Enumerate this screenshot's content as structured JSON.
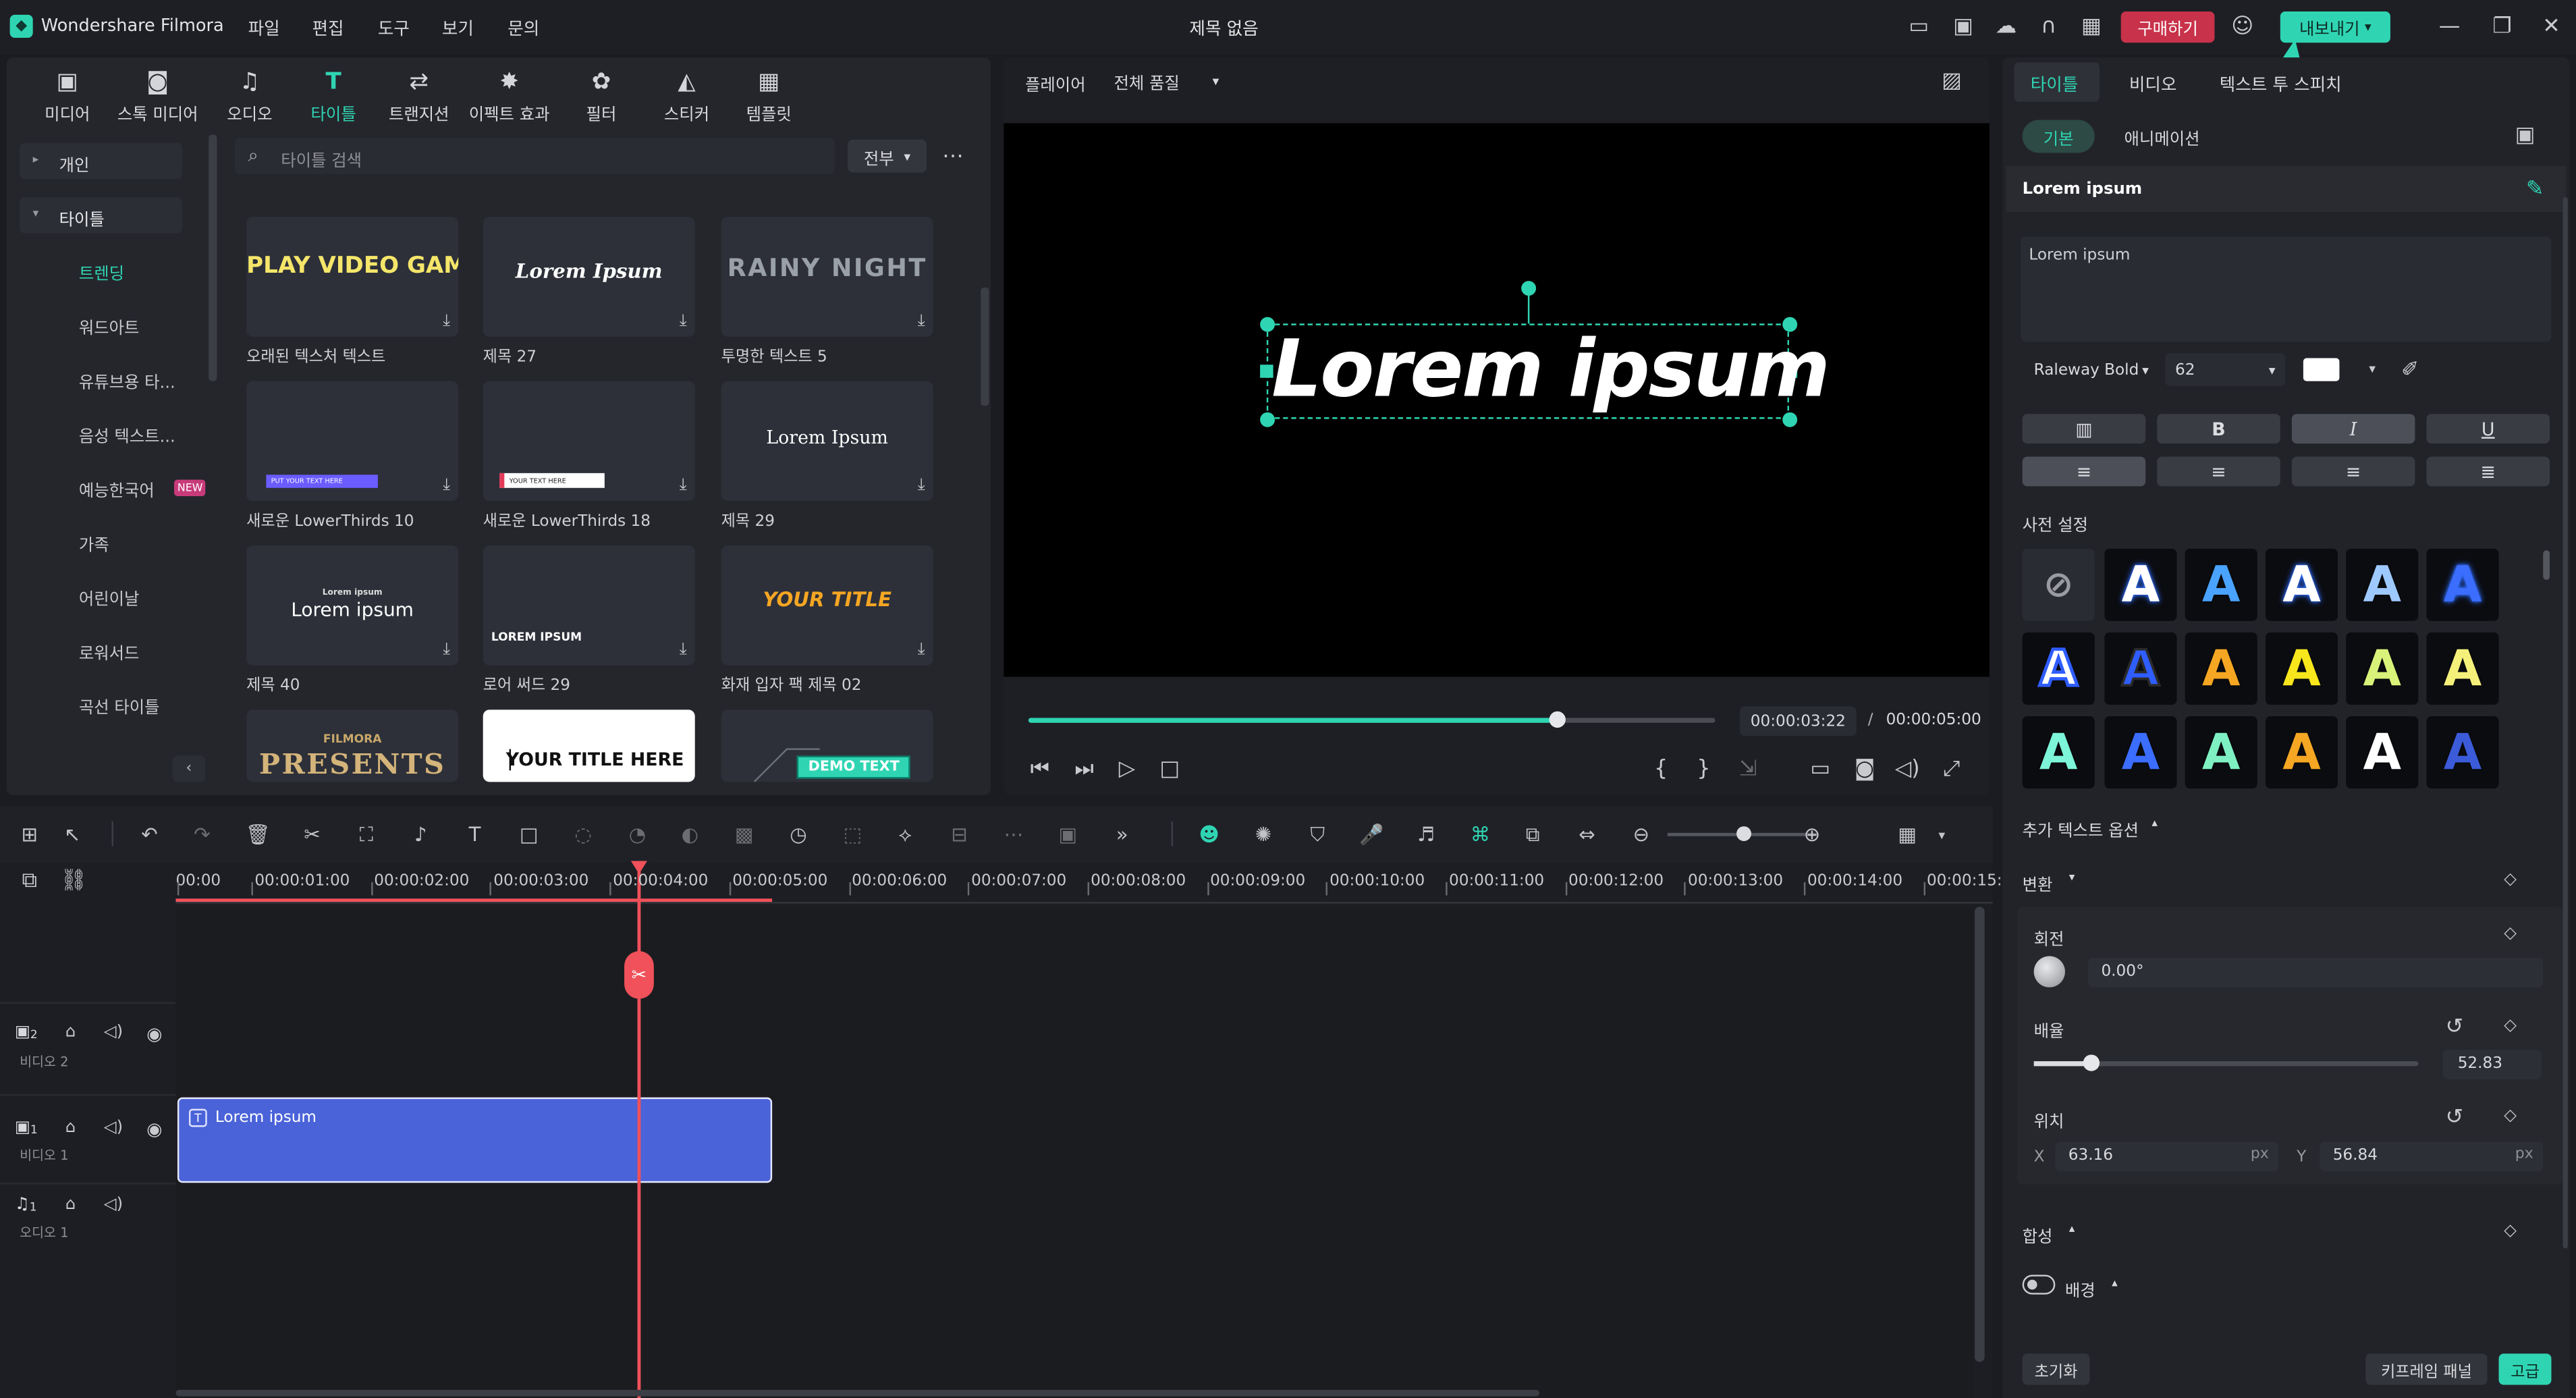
{
  "app": {
    "name": "Wondershare Filmora",
    "doc_title": "제목 없음",
    "buy_label": "구매하기",
    "export_label": "내보내기"
  },
  "menu": [
    "파일",
    "편집",
    "도구",
    "보기",
    "문의"
  ],
  "media_tabs": [
    {
      "label": "미디어",
      "icon": "media-icon"
    },
    {
      "label": "스톡 미디어",
      "icon": "stock-media-icon"
    },
    {
      "label": "오디오",
      "icon": "music-icon"
    },
    {
      "label": "타이틀",
      "icon": "title-T-icon"
    },
    {
      "label": "트랜지션",
      "icon": "transition-icon"
    },
    {
      "label": "이펙트 효과",
      "icon": "effects-icon"
    },
    {
      "label": "필터",
      "icon": "filter-icon"
    },
    {
      "label": "스티커",
      "icon": "sticker-icon"
    },
    {
      "label": "템플릿",
      "icon": "template-icon"
    }
  ],
  "sidebar": {
    "personal": "개인",
    "titles": "타이틀",
    "items": [
      "트렌딩",
      "워드아트",
      "유튜브용 타...",
      "음성 텍스트...",
      "예능한국어",
      "가족",
      "어린이날",
      "로워서드",
      "곡선 타이틀"
    ],
    "new_badge": "NEW"
  },
  "search": {
    "placeholder": "타이틀 검색",
    "filter": "전부"
  },
  "thumbs": [
    {
      "caption": "오래된 텍스처 텍스트",
      "text": "PLAY VIDEO GAME"
    },
    {
      "caption": "제목 27",
      "text": "Lorem Ipsum"
    },
    {
      "caption": "투명한 텍스트 5",
      "text": "RAINY NIGHT"
    },
    {
      "caption": "새로운 LowerThirds 10",
      "text": "PUT YOUR TEXT HERE"
    },
    {
      "caption": "새로운 LowerThirds 18",
      "text": "YOUR TEXT HERE"
    },
    {
      "caption": "제목 29",
      "text": "Lorem Ipsum"
    },
    {
      "caption": "제목 40",
      "text": "Lorem ipsum",
      "text_small": "Lorem ipsum"
    },
    {
      "caption": "로어 써드 29",
      "text": "LOREM IPSUM"
    },
    {
      "caption": "화재 입자 팩 제목 02",
      "text": "YOUR TITLE"
    },
    {
      "caption": "",
      "text": "PRESENTS",
      "text_small": "FILMORA"
    },
    {
      "caption": "",
      "text": "YOUR TITLE HERE"
    },
    {
      "caption": "",
      "text": "DEMO TEXT"
    }
  ],
  "player": {
    "label": "플레이어",
    "quality": "전체 품질",
    "overlay_text": "Lorem ipsum",
    "current": "00:00:03:22",
    "total": "00:00:05:00",
    "progress": 0.77
  },
  "right": {
    "tabs": [
      "타이틀",
      "비디오",
      "텍스트 투 스피치"
    ],
    "subtabs": [
      "기본",
      "애니메이션"
    ],
    "section_title": "Lorem ipsum",
    "text_value": "Lorem ipsum",
    "font": "Raleway Bold",
    "size": "62",
    "fmt": [
      "B",
      "I",
      "U"
    ],
    "presets_label": "사전 설정",
    "more_opts": "추가 텍스트 옵션",
    "transform": "변환",
    "rotate": "회전",
    "rotate_val": "0.00°",
    "scale": "배율",
    "scale_val": "52.83",
    "position": "위치",
    "pos_x_label": "X",
    "pos_x": "63.16",
    "pos_y_label": "Y",
    "pos_y": "56.84",
    "unit": "px",
    "composite": "합성",
    "background": "배경",
    "reset": "초기화",
    "keyframe": "키프레임 패널",
    "advanced": "고급"
  },
  "preset_colors": [
    [
      "#ffffff",
      "#4aa3ff",
      "#ffffff",
      "#9ec9ff",
      "#3b6dff",
      "#4d7dff"
    ],
    [
      "#ffffff",
      "#2f5dff",
      "#f5a623",
      "#f8e71c",
      "#d9f27a",
      "#f5f07a",
      "#b8f27a"
    ],
    [
      "#7cf5d8",
      "#3b6dff",
      "#7ef0c2",
      "#f5a623",
      "#ffffff",
      "#3b5bd8"
    ]
  ],
  "timeline": {
    "ticks": [
      "00:00",
      "00:00:01:00",
      "00:00:02:00",
      "00:00:03:00",
      "00:00:04:00",
      "00:00:05:00",
      "00:00:06:00",
      "00:00:07:00",
      "00:00:08:00",
      "00:00:09:00",
      "00:00:10:00",
      "00:00:11:00",
      "00:00:12:00",
      "00:00:13:00",
      "00:00:14:00",
      "00:00:15:"
    ],
    "tracks": [
      {
        "num": "2",
        "label": "비디오 2"
      },
      {
        "num": "1",
        "label": "비디오 1"
      },
      {
        "num": "1",
        "label": "오디오 1"
      }
    ],
    "clip_label": "Lorem ipsum"
  },
  "colors": {
    "accent": "#2fd5b3",
    "clip": "#4a63d8",
    "playhead": "#f0515a",
    "buy": "#c8324a"
  }
}
